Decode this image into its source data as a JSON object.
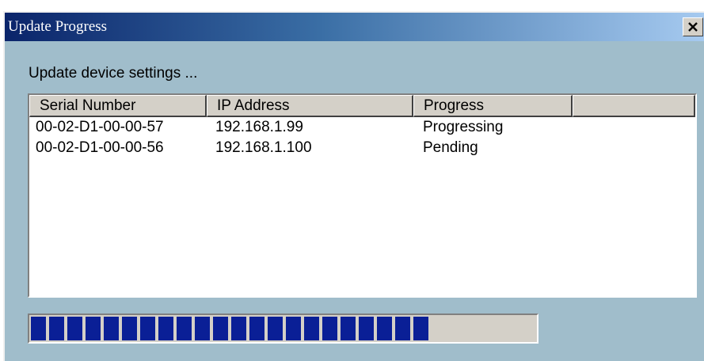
{
  "window": {
    "title": "Update Progress",
    "close_icon": "close-x-icon"
  },
  "message": "Update device settings ...",
  "table": {
    "columns": [
      "Serial Number",
      "IP Address",
      "Progress",
      ""
    ],
    "rows": [
      {
        "serial": "00-02-D1-00-00-57",
        "ip": "192.168.1.99",
        "progress": "Progressing"
      },
      {
        "serial": "00-02-D1-00-00-56",
        "ip": "192.168.1.100",
        "progress": "Pending"
      }
    ]
  },
  "progress": {
    "fraction": 0.82,
    "color": "#0a1f96"
  },
  "colors": {
    "dialog_background": "#a0bdcb",
    "title_gradient_start": "#0a246a",
    "title_gradient_end": "#a6caf0"
  }
}
